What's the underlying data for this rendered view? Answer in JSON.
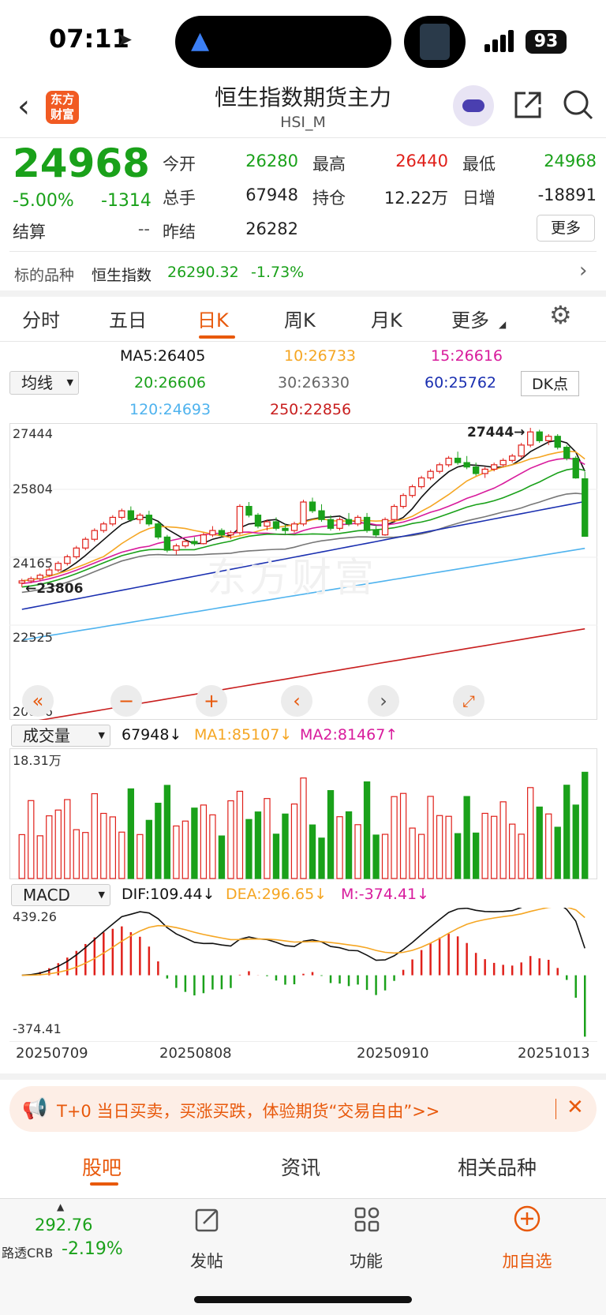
{
  "status_bar": {
    "time": "07:11",
    "battery": "93"
  },
  "header": {
    "title": "恒生指数期货主力",
    "code": "HSI_M",
    "logo_text": "东方财富"
  },
  "quote": {
    "price": "24968",
    "change_pct": "-5.00%",
    "change": "-1314",
    "open_label": "今开",
    "open": "26280",
    "high_label": "最高",
    "high": "26440",
    "low_label": "最低",
    "low": "24968",
    "volume_label": "总手",
    "volume": "67948",
    "oi_label": "持仓",
    "oi": "12.22万",
    "daily_inc_label": "日增",
    "daily_inc": "-18891",
    "settle_label": "结算",
    "settle": "--",
    "prev_settle_label": "昨结",
    "prev_settle": "26282",
    "more_label": "更多"
  },
  "underlying": {
    "label": "标的品种",
    "name": "恒生指数",
    "value": "26290.32",
    "pct": "-1.73%"
  },
  "tabs": [
    "分时",
    "五日",
    "日K",
    "周K",
    "月K",
    "更多"
  ],
  "active_tab": "日K",
  "ma_select": "均线",
  "ma": {
    "ma5": "MA5:26405",
    "ma10": "10:26733",
    "ma15": "15:26616",
    "ma20": "20:26606",
    "ma30": "30:26330",
    "ma60": "60:25762",
    "ma120": "120:24693",
    "ma250": "250:22856"
  },
  "dk_label": "DK点",
  "price_axis": [
    "27444",
    "25804",
    "24165",
    "22525",
    "20886"
  ],
  "marks": {
    "high": "27444",
    "low": "23806"
  },
  "watermark": "东方财富",
  "vol_panel": {
    "select": "成交量",
    "value": "67948",
    "ma1": "MA1:85107",
    "ma2": "MA2:81467",
    "axis_top": "18.31万"
  },
  "macd_panel": {
    "select": "MACD",
    "dif": "DIF:109.44",
    "dea": "DEA:296.65",
    "m": "M:-374.41",
    "axis_top": "439.26",
    "axis_bottom": "-374.41"
  },
  "dates": [
    "20250709",
    "20250808",
    "20250910",
    "20251013"
  ],
  "banner": {
    "text": "T+0 当日买卖，买涨买跌，体验期货“交易自由”>>"
  },
  "bottom_tabs": [
    "股吧",
    "资讯",
    "相关品种"
  ],
  "bottom_nav": {
    "index_value": "292.76",
    "index_name": "路透CRB",
    "index_pct": "-2.19%",
    "post": "发帖",
    "func": "功能",
    "add": "加自选"
  },
  "colors": {
    "up": "#e0201a",
    "down": "#1aa11a",
    "accent": "#e8590c"
  },
  "chart_data": {
    "type": "candlestick",
    "y_range": [
      20886,
      27444
    ],
    "candles": [
      [
        23900,
        24000,
        23806,
        23950
      ],
      [
        23950,
        24050,
        23900,
        24000
      ],
      [
        24000,
        24120,
        23950,
        24080
      ],
      [
        24080,
        24250,
        24050,
        24200
      ],
      [
        24200,
        24400,
        24150,
        24350
      ],
      [
        24350,
        24550,
        24300,
        24500
      ],
      [
        24500,
        24750,
        24450,
        24700
      ],
      [
        24700,
        24950,
        24650,
        24900
      ],
      [
        24900,
        25150,
        24850,
        25100
      ],
      [
        25100,
        25300,
        25050,
        25250
      ],
      [
        25250,
        25450,
        25200,
        25400
      ],
      [
        25400,
        25600,
        25350,
        25550
      ],
      [
        25550,
        25650,
        25300,
        25350
      ],
      [
        25350,
        25500,
        25250,
        25450
      ],
      [
        25450,
        25550,
        25200,
        25250
      ],
      [
        25250,
        25300,
        24900,
        24950
      ],
      [
        24950,
        25000,
        24600,
        24650
      ],
      [
        24650,
        24800,
        24550,
        24750
      ],
      [
        24750,
        24900,
        24700,
        24850
      ],
      [
        24850,
        24950,
        24750,
        24800
      ],
      [
        24800,
        25050,
        24780,
        25000
      ],
      [
        25000,
        25200,
        24950,
        25100
      ],
      [
        25100,
        25150,
        24950,
        25000
      ],
      [
        25000,
        25100,
        24900,
        25050
      ],
      [
        25050,
        25700,
        25000,
        25650
      ],
      [
        25650,
        25750,
        25400,
        25450
      ],
      [
        25450,
        25500,
        25150,
        25200
      ],
      [
        25200,
        25350,
        25100,
        25300
      ],
      [
        25300,
        25400,
        25100,
        25150
      ],
      [
        25150,
        25250,
        25000,
        25100
      ],
      [
        25100,
        25300,
        25050,
        25250
      ],
      [
        25250,
        25800,
        25200,
        25750
      ],
      [
        25750,
        25850,
        25500,
        25550
      ],
      [
        25550,
        25700,
        25300,
        25350
      ],
      [
        25350,
        25450,
        25100,
        25150
      ],
      [
        25150,
        25400,
        25100,
        25350
      ],
      [
        25350,
        25500,
        25200,
        25250
      ],
      [
        25250,
        25450,
        25200,
        25400
      ],
      [
        25400,
        25500,
        25050,
        25100
      ],
      [
        25100,
        25200,
        24950,
        25000
      ],
      [
        25000,
        25400,
        24980,
        25350
      ],
      [
        25350,
        25700,
        25300,
        25650
      ],
      [
        25650,
        25950,
        25600,
        25900
      ],
      [
        25900,
        26150,
        25850,
        26100
      ],
      [
        26100,
        26350,
        26050,
        26300
      ],
      [
        26300,
        26500,
        26250,
        26450
      ],
      [
        26450,
        26650,
        26400,
        26600
      ],
      [
        26600,
        26800,
        26550,
        26750
      ],
      [
        26750,
        26900,
        26600,
        26650
      ],
      [
        26650,
        26800,
        26500,
        26550
      ],
      [
        26550,
        26650,
        26350,
        26400
      ],
      [
        26400,
        26550,
        26300,
        26500
      ],
      [
        26500,
        26650,
        26450,
        26600
      ],
      [
        26600,
        26750,
        26550,
        26700
      ],
      [
        26700,
        26850,
        26650,
        26800
      ],
      [
        26800,
        27100,
        26750,
        27050
      ],
      [
        27050,
        27444,
        27000,
        27350
      ],
      [
        27350,
        27400,
        27100,
        27150
      ],
      [
        27150,
        27300,
        27050,
        27250
      ],
      [
        27250,
        27300,
        26950,
        27000
      ],
      [
        27000,
        27050,
        26700,
        26750
      ],
      [
        26750,
        26800,
        26282,
        26300
      ],
      [
        26280,
        26440,
        24968,
        24968
      ]
    ],
    "volume_max": 18.31,
    "macd_range": [
      -374.41,
      439.26
    ]
  }
}
